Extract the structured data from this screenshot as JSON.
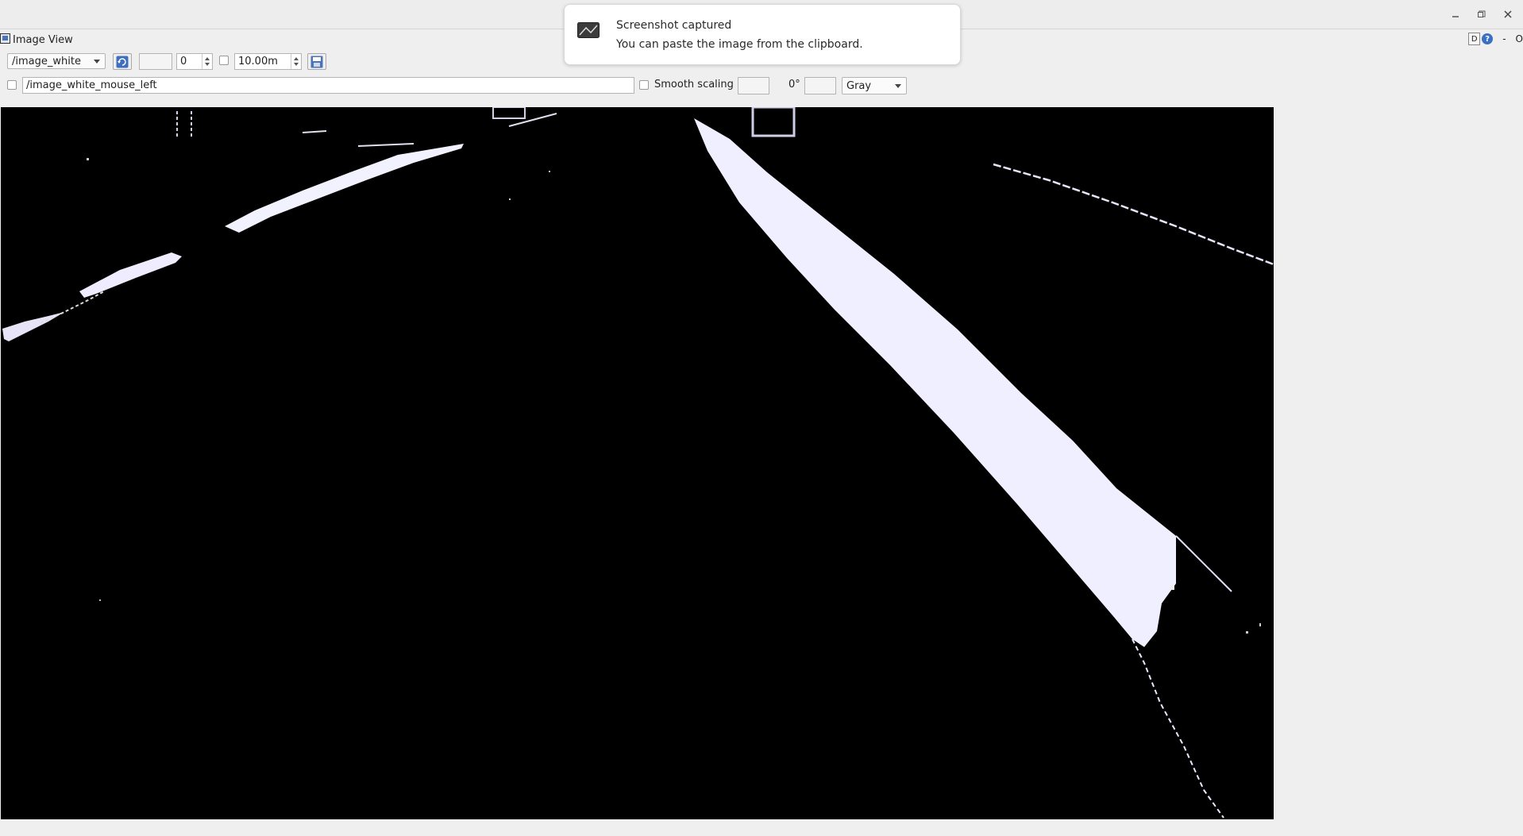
{
  "window": {
    "minimize_icon": "minimize-icon",
    "maximize_icon": "maximize-icon",
    "close_icon": "close-icon"
  },
  "notification": {
    "title": "Screenshot captured",
    "message": "You can paste the image from the clipboard."
  },
  "plugin": {
    "title": "Image View",
    "topright_d": "D",
    "topright_help": "?",
    "topright_o": "O"
  },
  "toolbar": {
    "topic": "/image_white",
    "refresh_icon": "refresh-icon",
    "spin_value": "0",
    "rate_value": "10.00m",
    "save_icon": "save-image-icon"
  },
  "row2": {
    "mouse_topic": "/image_white_mouse_left",
    "smooth_scaling_label": "Smooth scaling",
    "rotation": "0°",
    "colormap": "Gray"
  },
  "colors": {
    "image_background": "#000000",
    "lane_fill": "#f0efff",
    "window_bg": "#efefef"
  }
}
